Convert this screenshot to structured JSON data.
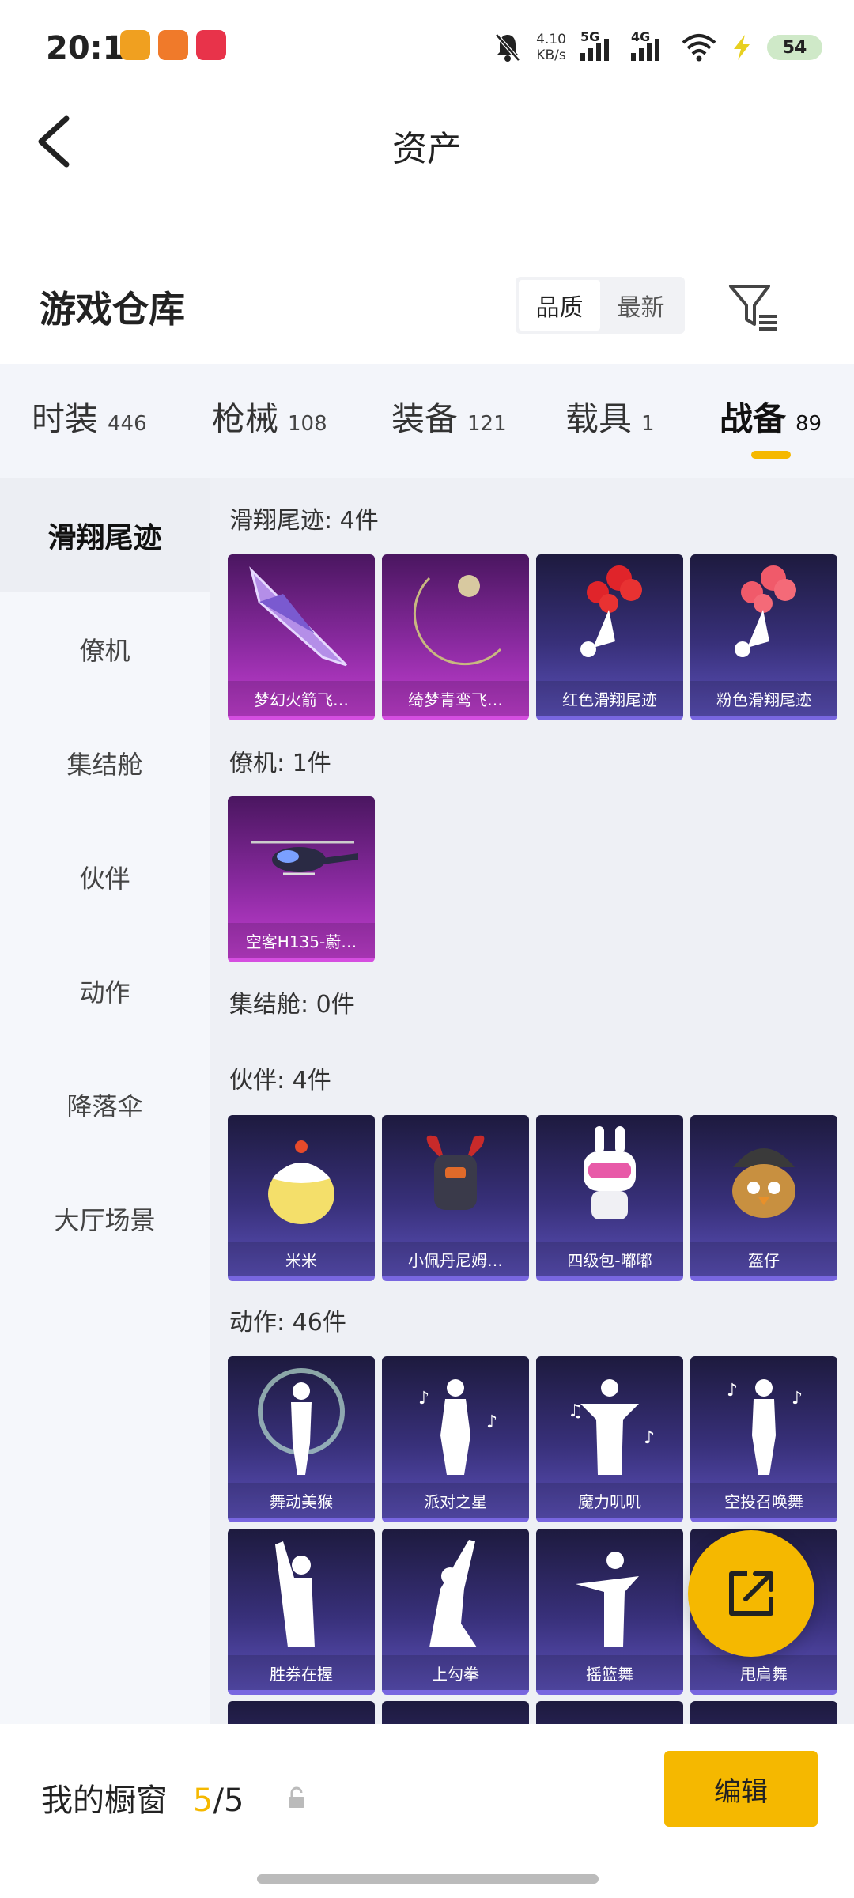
{
  "status": {
    "time": "20:19",
    "net_speed_value": "4.10",
    "net_speed_unit": "KB/s",
    "signal1_label": "5G",
    "signal2_label": "4G",
    "battery": "54"
  },
  "header": {
    "title": "资产"
  },
  "warehouse": {
    "title": "游戏仓库",
    "sort_options": [
      "品质",
      "最新"
    ],
    "sort_active": "品质"
  },
  "tabs": [
    {
      "label": "时装",
      "count": "446"
    },
    {
      "label": "枪械",
      "count": "108"
    },
    {
      "label": "装备",
      "count": "121"
    },
    {
      "label": "载具",
      "count": "1"
    },
    {
      "label": "战备",
      "count": "89"
    }
  ],
  "sidebar": {
    "items": [
      "滑翔尾迹",
      "僚机",
      "集结舱",
      "伙伴",
      "动作",
      "降落伞",
      "大厅场景"
    ],
    "active": "滑翔尾迹"
  },
  "sections": [
    {
      "title": "滑翔尾迹: 4件",
      "items": [
        {
          "label": "梦幻火箭飞…",
          "rarity": "purple",
          "icon": "glider-icon"
        },
        {
          "label": "绮梦青鸾飞…",
          "rarity": "purple",
          "icon": "crescent-moon-icon"
        },
        {
          "label": "红色滑翔尾迹",
          "rarity": "blue",
          "icon": "red-smoke-trail-icon"
        },
        {
          "label": "粉色滑翔尾迹",
          "rarity": "blue",
          "icon": "pink-smoke-trail-icon"
        }
      ]
    },
    {
      "title": "僚机: 1件",
      "items": [
        {
          "label": "空客H135-蔚…",
          "rarity": "purple",
          "icon": "helicopter-icon"
        }
      ]
    },
    {
      "title": "集结舱: 0件",
      "items": []
    },
    {
      "title": "伙伴: 4件",
      "items": [
        {
          "label": "米米",
          "rarity": "blue",
          "icon": "chick-icon"
        },
        {
          "label": "小佩丹尼姆…",
          "rarity": "blue",
          "icon": "mech-companion-icon"
        },
        {
          "label": "四级包-嘟嘟",
          "rarity": "blue",
          "icon": "bunny-robot-icon"
        },
        {
          "label": "盔仔",
          "rarity": "blue",
          "icon": "helmet-chick-icon"
        }
      ]
    },
    {
      "title": "动作: 46件",
      "items": [
        {
          "label": "舞动美猴",
          "rarity": "blue",
          "icon": "dance-emote-icon"
        },
        {
          "label": "派对之星",
          "rarity": "blue",
          "icon": "dance-emote-icon"
        },
        {
          "label": "魔力叽叽",
          "rarity": "blue",
          "icon": "dance-emote-icon"
        },
        {
          "label": "空投召唤舞",
          "rarity": "blue",
          "icon": "dance-emote-icon"
        },
        {
          "label": "胜券在握",
          "rarity": "blue",
          "icon": "dance-emote-icon"
        },
        {
          "label": "上勾拳",
          "rarity": "blue",
          "icon": "dance-emote-icon"
        },
        {
          "label": "摇篮舞",
          "rarity": "blue",
          "icon": "dance-emote-icon"
        },
        {
          "label": "甩肩舞",
          "rarity": "blue",
          "icon": "dance-emote-icon"
        }
      ]
    }
  ],
  "showcase": {
    "title": "我的橱窗",
    "current": "5",
    "separator": "/",
    "total": "5",
    "edit_label": "编辑"
  },
  "colors": {
    "accent": "#f5b800",
    "rarity_purple": "#c23ed0",
    "rarity_blue": "#5b50b8"
  }
}
